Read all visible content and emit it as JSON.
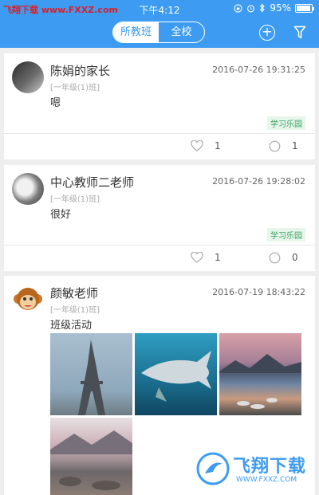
{
  "status_bar": {
    "carrier": "飞翔下载 www.FXXZ.com",
    "time": "下午4:12",
    "battery": "95%",
    "battery_level": 0.95,
    "icons": [
      "lock-rotation-icon",
      "alarm-icon",
      "bluetooth-icon",
      "battery-icon"
    ]
  },
  "nav": {
    "tabs": [
      {
        "label": "所教班",
        "active": true
      },
      {
        "label": "全校",
        "active": false
      }
    ],
    "icons": [
      "add-icon",
      "filter-icon"
    ]
  },
  "posts": [
    {
      "author": "陈娟的家长",
      "timestamp": "2016-07-26 19:31:25",
      "class": "[一年级(1)班]",
      "content": "嗯",
      "tag": "学习乐园",
      "likes": "1",
      "comments": "1"
    },
    {
      "author": "中心教师二老师",
      "timestamp": "2016-07-26 19:28:02",
      "class": "[一年级(1)班]",
      "content": "很好",
      "tag": "学习乐园",
      "likes": "1",
      "comments": "0"
    },
    {
      "author": "颜敏老师",
      "timestamp": "2016-07-19 18:43:22",
      "class": "[一年级(1)班]",
      "content": "班级活动",
      "photos": [
        "eiffel-tower-photo",
        "shark-photo",
        "lake-sunset-photo",
        "mountain-lake-photo"
      ]
    }
  ],
  "watermark": {
    "text": "飞翔下载",
    "url": "WWW.FXXZ.COM"
  },
  "colors": {
    "brand": "#3d9cf1",
    "tag_green": "#3aa35f"
  }
}
